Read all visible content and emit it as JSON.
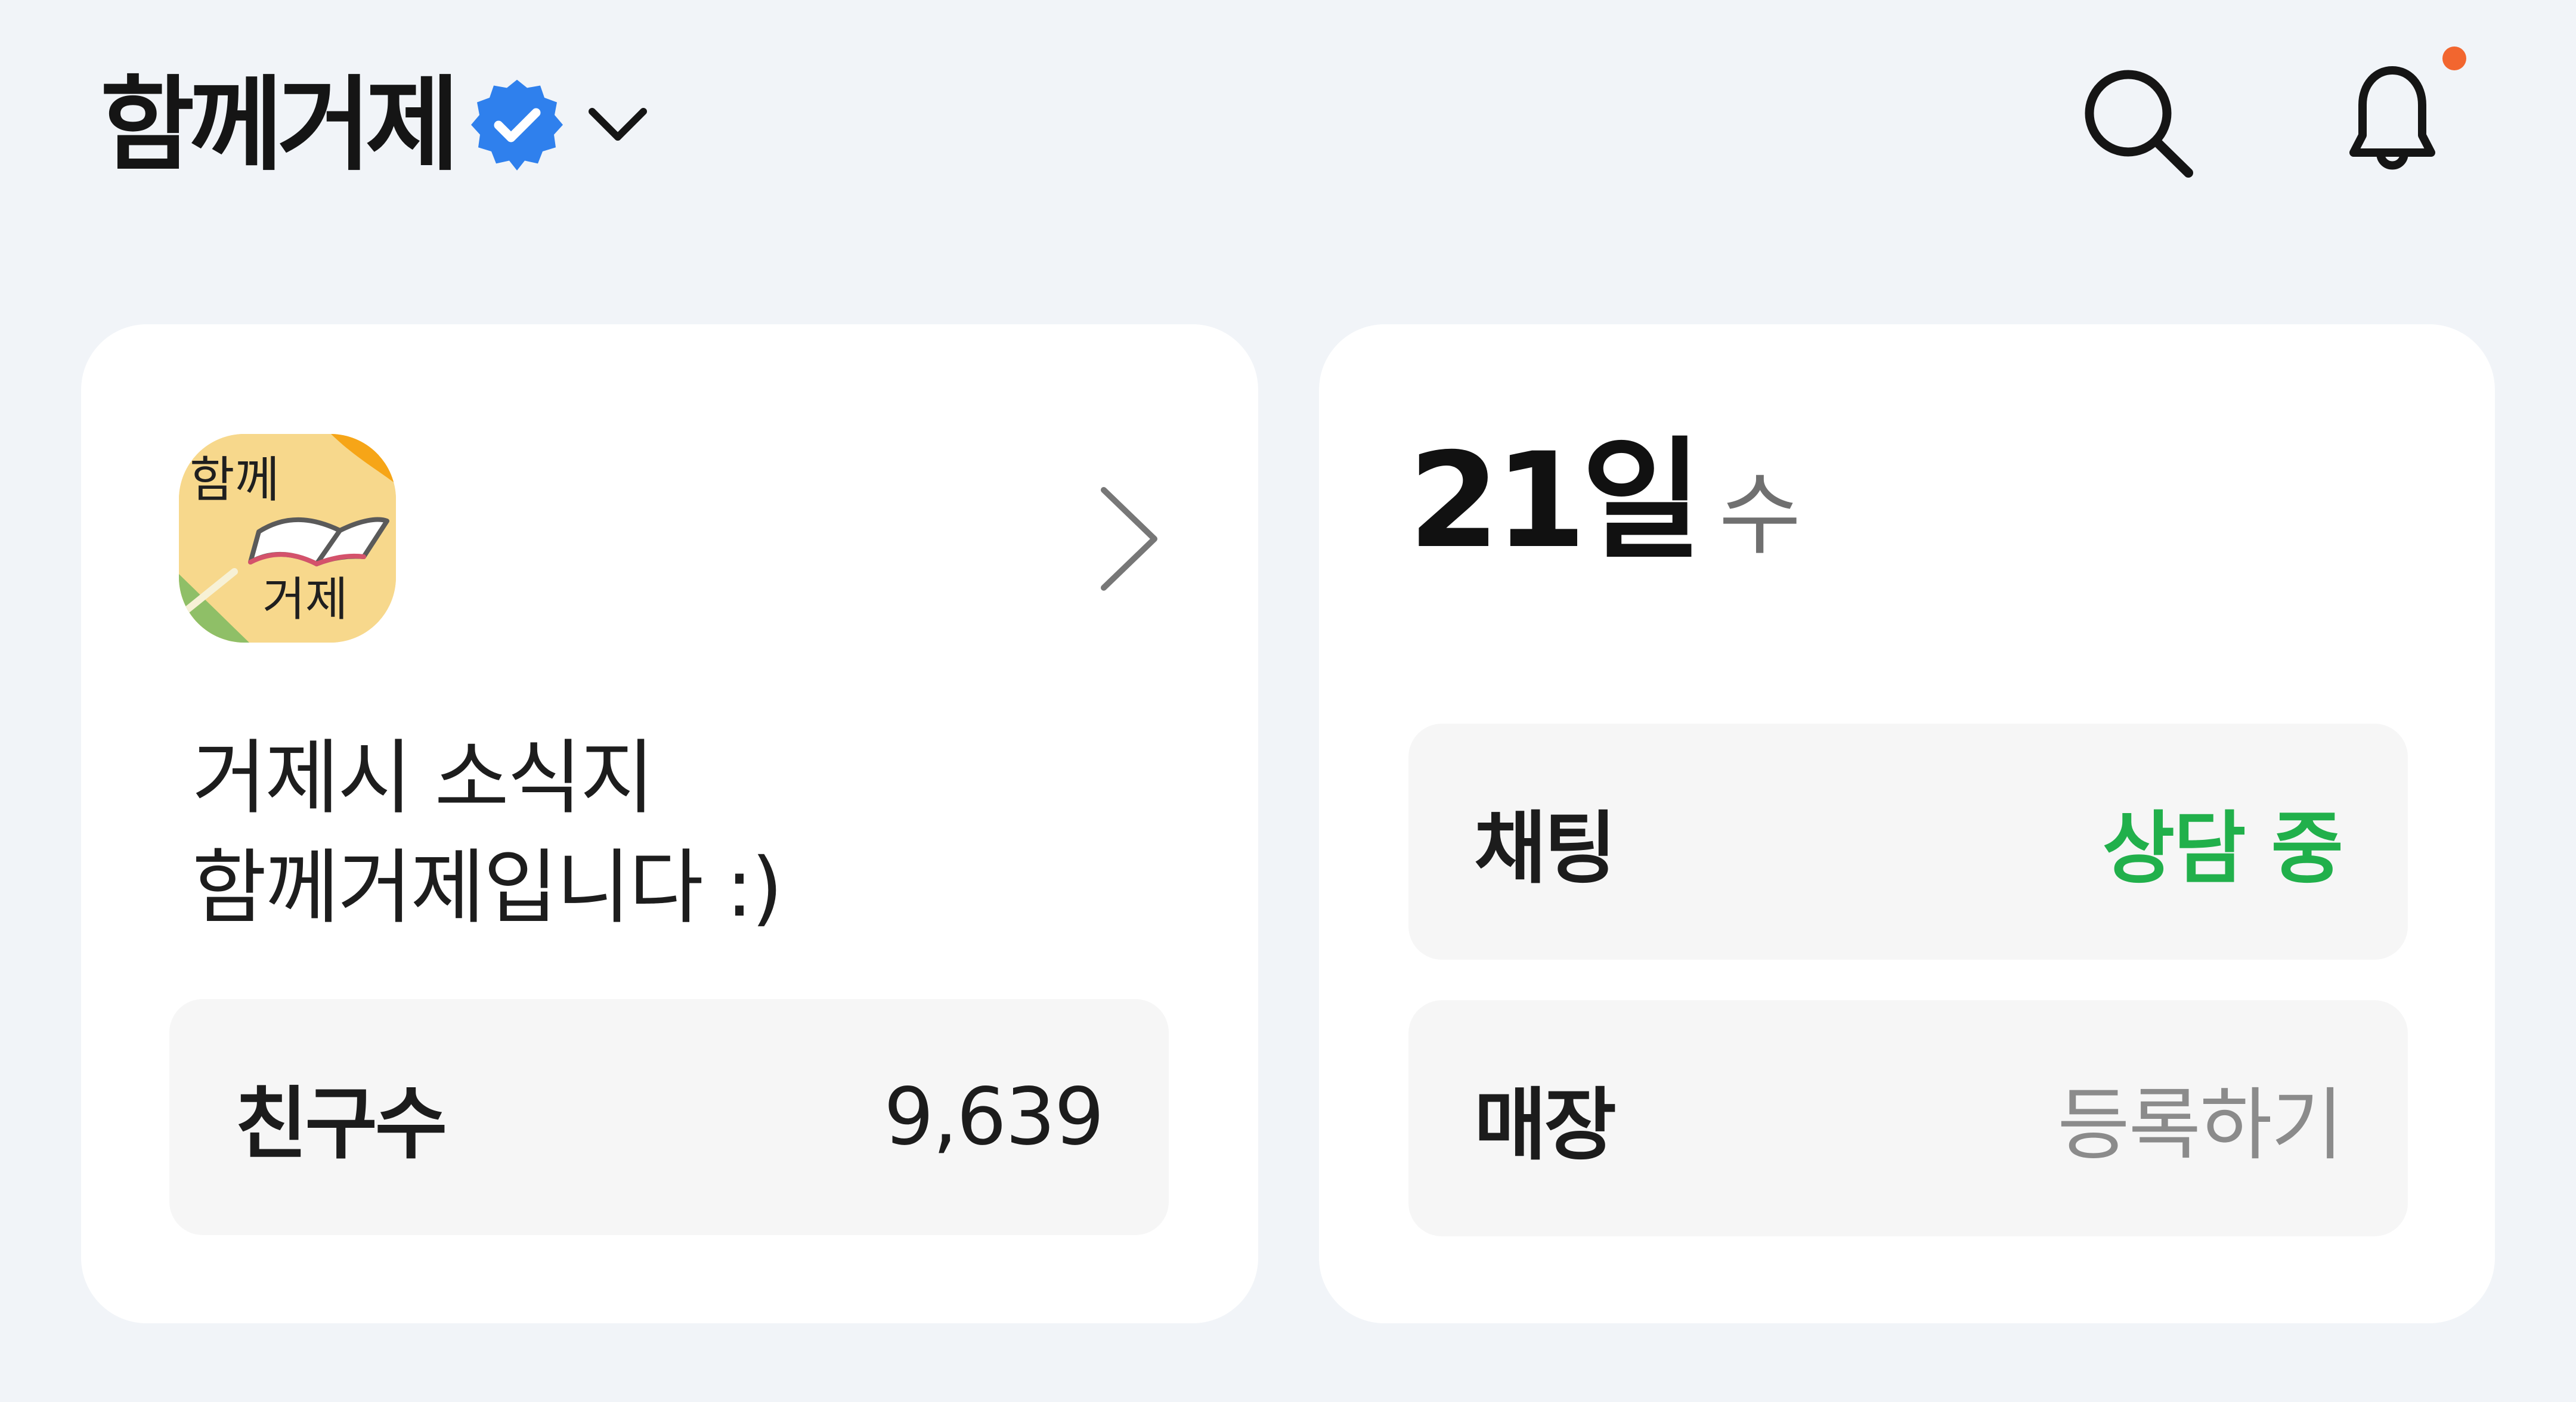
{
  "header": {
    "title": "함께거제",
    "verified_icon": "verified-badge-icon",
    "dropdown_icon": "chevron-down-icon",
    "search_icon": "search-icon",
    "bell_icon": "bell-icon",
    "has_notification": true,
    "colors": {
      "verified": "#2F80ED",
      "notification_dot": "#F2662F"
    }
  },
  "profile_card": {
    "logo_lines": [
      "함께",
      "거제"
    ],
    "arrow_icon": "chevron-right-icon",
    "description_lines": [
      "거제시 소식지",
      "함께거제입니다 :)"
    ],
    "friends": {
      "label": "친구수",
      "value": "9,639"
    }
  },
  "status_card": {
    "date": "21일",
    "weekday": "수",
    "chat": {
      "label": "채팅",
      "status": "상담 중",
      "status_color": "#21B04B"
    },
    "store": {
      "label": "매장",
      "action": "등록하기",
      "action_color": "#8B8B8B"
    }
  }
}
